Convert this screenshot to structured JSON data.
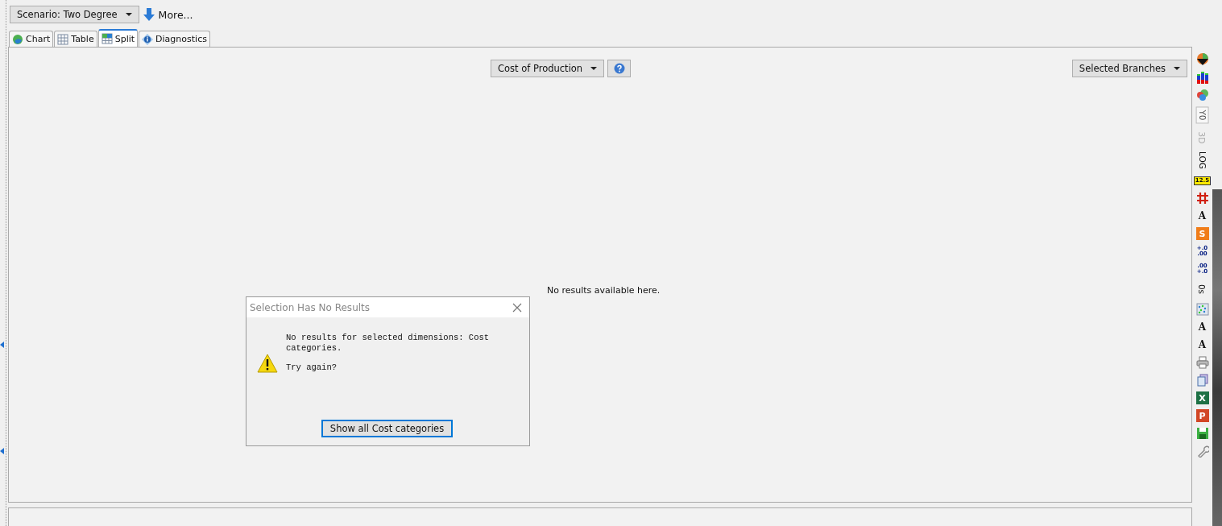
{
  "scenario_dropdown": {
    "label": "Scenario: Two Degree"
  },
  "more_button": {
    "label": "More..."
  },
  "tabs": [
    {
      "label": "Chart",
      "selected": false
    },
    {
      "label": "Table",
      "selected": false
    },
    {
      "label": "Split",
      "selected": true
    },
    {
      "label": "Diagnostics",
      "selected": false
    }
  ],
  "variable_dropdown": {
    "label": "Cost of Production"
  },
  "branches_dropdown": {
    "label": "Selected Branches"
  },
  "message": "No results available here.",
  "dialog": {
    "title": "Selection Has No Results",
    "text": "No results for selected dimensions: Cost categories.",
    "question": "Try again?",
    "button": "Show all Cost categories"
  },
  "toolbar": [
    {
      "kind": "icon"
    },
    {
      "kind": "icon"
    },
    {
      "kind": "icon"
    },
    {
      "kind": "vtext",
      "label": "Y0",
      "selected": true,
      "disabled": false
    },
    {
      "kind": "vtext",
      "label": "3D",
      "selected": false,
      "disabled": true
    },
    {
      "kind": "vtext",
      "label": "LOG",
      "selected": false,
      "disabled": false
    },
    {
      "kind": "badge",
      "label": "12.5"
    },
    {
      "kind": "icon"
    },
    {
      "kind": "glyph",
      "label": "A"
    },
    {
      "kind": "tile",
      "label": "S",
      "color": "#f07d1a"
    },
    {
      "kind": "stack",
      "lines": [
        "+.0",
        ".00"
      ]
    },
    {
      "kind": "stack",
      "lines": [
        ".00",
        "+.0"
      ]
    },
    {
      "kind": "vtext",
      "label": "0s",
      "selected": false,
      "disabled": false
    },
    {
      "kind": "icon"
    },
    {
      "kind": "glyph",
      "label": "A"
    },
    {
      "kind": "glyph",
      "label": "A"
    },
    {
      "kind": "icon"
    },
    {
      "kind": "icon"
    },
    {
      "kind": "tile",
      "label": "X",
      "color": "#1e7145"
    },
    {
      "kind": "tile",
      "label": "P",
      "color": "#d24726"
    },
    {
      "kind": "icon"
    },
    {
      "kind": "icon"
    }
  ]
}
